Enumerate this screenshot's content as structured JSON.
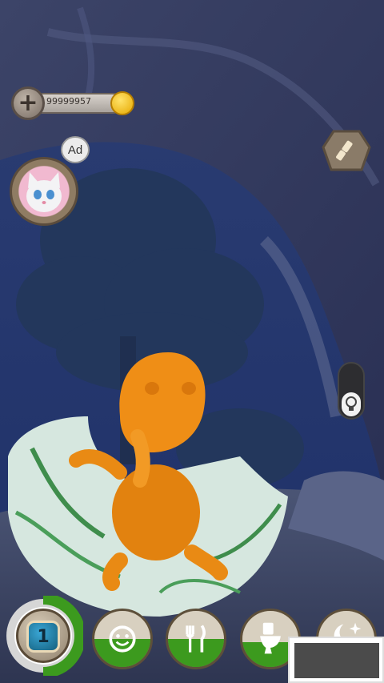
{
  "hud": {
    "coins": "99999957",
    "add_symbol": "+",
    "ad_label": "Ad"
  },
  "needs": {
    "level": "1",
    "happiness": 0.5,
    "food": 0.5,
    "toilet": 0.45,
    "sleep": 0.3
  },
  "colors": {
    "sky": "#1a2a55",
    "need_fill": "#3c9a1e",
    "dino": "#e98a14"
  }
}
